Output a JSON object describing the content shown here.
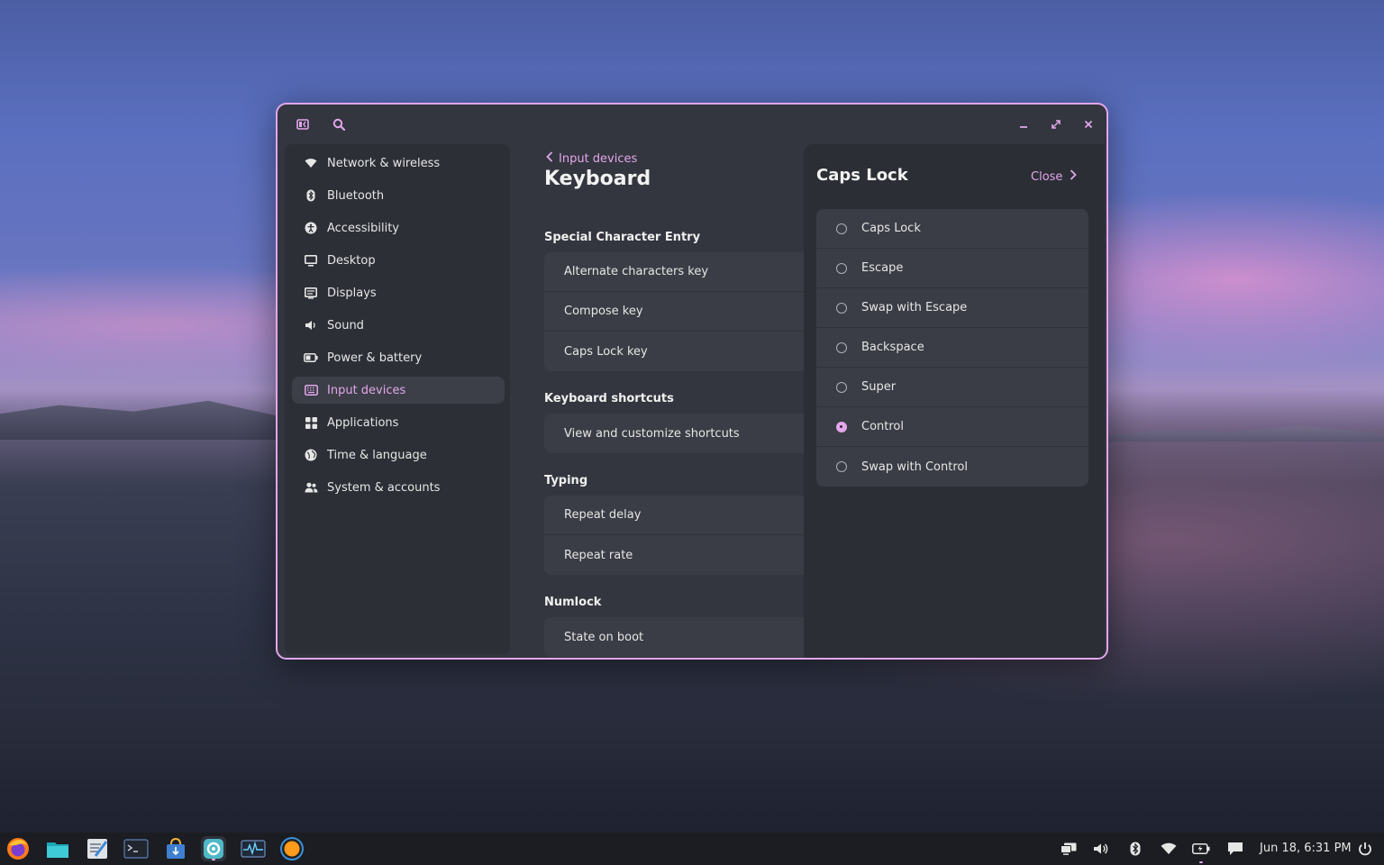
{
  "window": {
    "titlebar": {
      "sidebar_toggle_icon": "sidebar-toggle-icon",
      "search_icon": "search-icon",
      "minimize": "minimize-icon",
      "maximize": "maximize-icon",
      "close": "close-icon"
    }
  },
  "sidebar": {
    "items": [
      {
        "label": "Network & wireless",
        "icon": "wifi-icon"
      },
      {
        "label": "Bluetooth",
        "icon": "bluetooth-icon"
      },
      {
        "label": "Accessibility",
        "icon": "accessibility-icon"
      },
      {
        "label": "Desktop",
        "icon": "monitor-icon"
      },
      {
        "label": "Displays",
        "icon": "displays-icon"
      },
      {
        "label": "Sound",
        "icon": "speaker-icon"
      },
      {
        "label": "Power & battery",
        "icon": "battery-icon"
      },
      {
        "label": "Input devices",
        "icon": "keyboard-icon",
        "active": true
      },
      {
        "label": "Applications",
        "icon": "grid-icon"
      },
      {
        "label": "Time & language",
        "icon": "globe-icon"
      },
      {
        "label": "System & accounts",
        "icon": "users-icon"
      }
    ]
  },
  "main": {
    "back_label": "Input devices",
    "title": "Keyboard",
    "sections": [
      {
        "heading": "Special Character Entry",
        "rows": [
          "Alternate characters key",
          "Compose key",
          "Caps Lock key"
        ]
      },
      {
        "heading": "Keyboard shortcuts",
        "rows": [
          "View and customize shortcuts"
        ]
      },
      {
        "heading": "Typing",
        "rows": [
          "Repeat delay",
          "Repeat rate"
        ]
      },
      {
        "heading": "Numlock",
        "rows": [
          "State on boot"
        ]
      }
    ]
  },
  "panel": {
    "title": "Caps Lock",
    "close_label": "Close",
    "options": [
      "Caps Lock",
      "Escape",
      "Swap with Escape",
      "Backspace",
      "Super",
      "Control",
      "Swap with Control"
    ],
    "selected": "Control"
  },
  "taskbar": {
    "apps": [
      "firefox-icon",
      "files-icon",
      "text-editor-icon",
      "terminal-icon",
      "app-store-icon",
      "settings-icon",
      "system-monitor-icon",
      "media-icon"
    ],
    "tray": [
      "displays-tray-icon",
      "volume-icon",
      "bluetooth-tray-icon",
      "wifi-tray-icon",
      "battery-tray-icon",
      "notifications-icon"
    ],
    "clock": "Jun 18, 6:31 PM",
    "power_icon": "power-icon"
  },
  "colors": {
    "accent": "#e3a6ec",
    "window_bg": "#33363e",
    "sidebar_bg": "#2c2f36",
    "row_bg": "#3a3d45",
    "panel_bg": "#2b2e35",
    "taskbar_bg": "#1b1d22"
  }
}
